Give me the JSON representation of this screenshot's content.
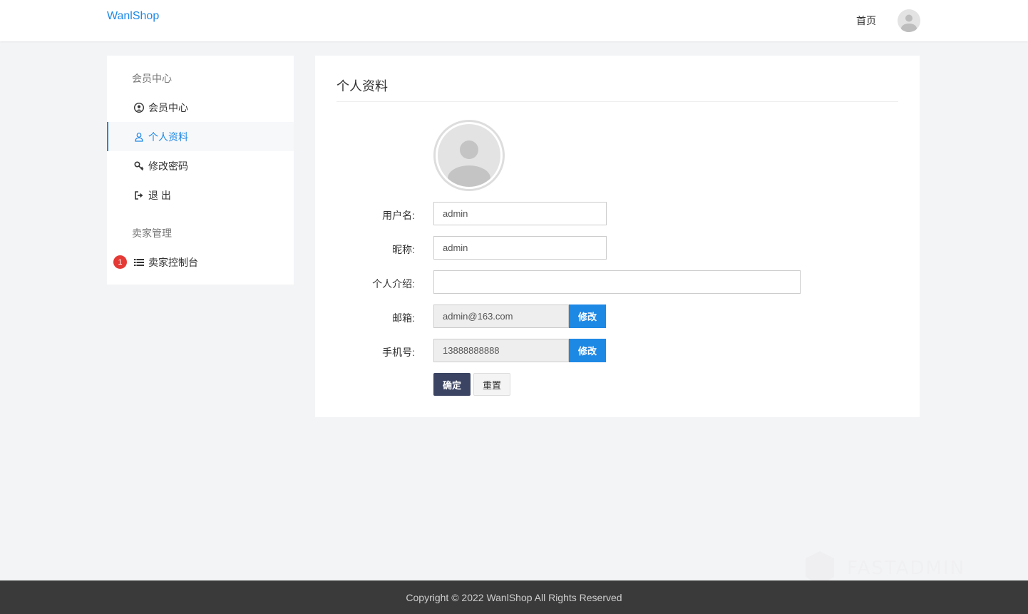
{
  "header": {
    "brand": "WanlShop",
    "nav_home": "首页"
  },
  "sidebar": {
    "groups": [
      {
        "title": "会员中心",
        "items": [
          {
            "label": "会员中心",
            "icon": "user-circle-icon"
          },
          {
            "label": "个人资料",
            "icon": "user-icon",
            "active": true
          },
          {
            "label": "修改密码",
            "icon": "key-icon"
          },
          {
            "label": "退 出",
            "icon": "sign-out-icon"
          }
        ]
      },
      {
        "title": "卖家管理",
        "items": [
          {
            "label": "卖家控制台",
            "icon": "list-icon",
            "badge": "1"
          }
        ]
      }
    ]
  },
  "profile": {
    "title": "个人资料",
    "fields": {
      "username": {
        "label": "用户名:",
        "value": "admin"
      },
      "nickname": {
        "label": "昵称:",
        "value": "admin"
      },
      "bio": {
        "label": "个人介绍:",
        "value": ""
      },
      "email": {
        "label": "邮箱:",
        "value": "admin@163.com",
        "action": "修改"
      },
      "mobile": {
        "label": "手机号:",
        "value": "13888888888",
        "action": "修改"
      }
    },
    "submit_label": "确定",
    "reset_label": "重置"
  },
  "watermark": "FASTADMIN",
  "footer": {
    "copyright": "Copyright © 2022 WanlShop All Rights Reserved"
  },
  "colors": {
    "accent": "#1e88e5",
    "primary_button": "#3b4463",
    "badge": "#e53935",
    "footer_bg": "#3a3a3a"
  }
}
